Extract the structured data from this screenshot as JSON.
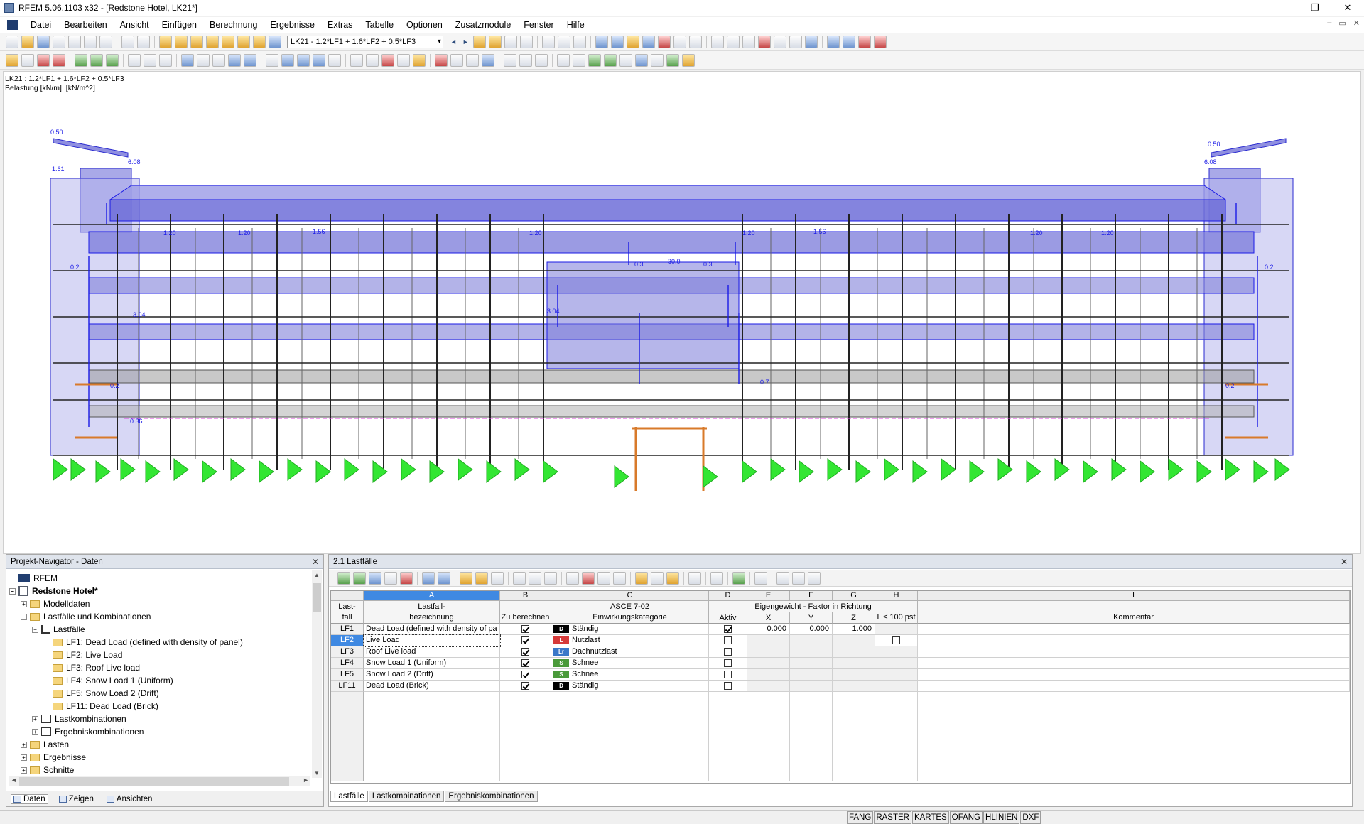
{
  "window": {
    "title": "RFEM 5.06.1103 x32 - [Redstone Hotel, LK21*]",
    "minimize": "—",
    "maximize": "❐",
    "close": "✕"
  },
  "menu": [
    "Datei",
    "Bearbeiten",
    "Ansicht",
    "Einfügen",
    "Berechnung",
    "Ergebnisse",
    "Extras",
    "Tabelle",
    "Optionen",
    "Zusatzmodule",
    "Fenster",
    "Hilfe"
  ],
  "mdi_controls": [
    "–",
    "▭",
    "✕"
  ],
  "toolbar": {
    "loadcase_combo": "LK21 - 1.2*LF1 + 1.6*LF2 + 0.5*LF3",
    "prev_arrow": "◄",
    "next_arrow": "►"
  },
  "viewport": {
    "info_line1": "LK21 : 1.2*LF1 + 1.6*LF2 + 0.5*LF3",
    "info_line2": "Belastung [kN/m], [kN/m^2]",
    "load_labels": {
      "top_left": "0.50",
      "top_right": "0.50",
      "parapet_left": "6.08",
      "parapet_right": "6.08",
      "side_left": "1.61",
      "floor_load": "1.20",
      "floor_load_b": "1.56",
      "center_span": "30.0",
      "wall_load": "3.04",
      "small_a": "0.2",
      "small_b": "0.3",
      "small_c": "0.7",
      "small_d": "0.36"
    },
    "colors": {
      "slab_fill": "#6f6fd8",
      "load_arrow": "#1a1ae6",
      "support": "#33e633",
      "steel": "#d87a2a"
    }
  },
  "navigator": {
    "title": "Projekt-Navigator - Daten",
    "close": "✕",
    "tree": [
      {
        "label": "RFEM",
        "level": 0,
        "icon": "root",
        "exp": ""
      },
      {
        "label": "Redstone Hotel*",
        "level": 0,
        "icon": "model",
        "exp": "−",
        "bold": true
      },
      {
        "label": "Modelldaten",
        "level": 1,
        "icon": "folder",
        "exp": "+"
      },
      {
        "label": "Lastfälle und Kombinationen",
        "level": 1,
        "icon": "folder",
        "exp": "−"
      },
      {
        "label": "Lastfälle",
        "level": 2,
        "icon": "lc",
        "exp": "−"
      },
      {
        "label": "LF1: Dead Load (defined with density of panel)",
        "level": 3,
        "icon": "folder",
        "exp": ""
      },
      {
        "label": "LF2: Live Load",
        "level": 3,
        "icon": "folder",
        "exp": ""
      },
      {
        "label": "LF3: Roof Live load",
        "level": 3,
        "icon": "folder",
        "exp": ""
      },
      {
        "label": "LF4: Snow Load 1 (Uniform)",
        "level": 3,
        "icon": "folder",
        "exp": ""
      },
      {
        "label": "LF5: Snow Load 2 (Drift)",
        "level": 3,
        "icon": "folder",
        "exp": ""
      },
      {
        "label": "LF11: Dead Load (Brick)",
        "level": 3,
        "icon": "folder",
        "exp": ""
      },
      {
        "label": "Lastkombinationen",
        "level": 2,
        "icon": "combo",
        "exp": "+"
      },
      {
        "label": "Ergebniskombinationen",
        "level": 2,
        "icon": "combo",
        "exp": "+"
      },
      {
        "label": "Lasten",
        "level": 1,
        "icon": "folder",
        "exp": "+"
      },
      {
        "label": "Ergebnisse",
        "level": 1,
        "icon": "folder",
        "exp": "+"
      },
      {
        "label": "Schnitte",
        "level": 1,
        "icon": "folder",
        "exp": "+"
      }
    ],
    "tabs": [
      "Daten",
      "Zeigen",
      "Ansichten"
    ]
  },
  "table": {
    "title": "2.1 Lastfälle",
    "close": "✕",
    "col_letters": [
      "A",
      "B",
      "C",
      "D",
      "E",
      "F",
      "G",
      "H",
      "I"
    ],
    "headers": {
      "lastfall": "Last-\nfall",
      "bezeichnung": "Lastfall-\nbezeichnung",
      "zu_berechnen": "Zu berechnen",
      "asce_top": "ASCE 7-02",
      "asce_bottom": "Einwirkungskategorie",
      "eigengewicht": "Eigengewicht  -  Faktor in Richtung",
      "aktiv": "Aktiv",
      "x": "X",
      "y": "Y",
      "z": "Z",
      "l100": "L ≤ 100 psf",
      "kommentar": "Kommentar"
    },
    "rows": [
      {
        "id": "LF1",
        "name": "Dead Load (defined with density of pa",
        "calc": true,
        "cat_code": "D",
        "cat_color": "#000000",
        "category": "Ständig",
        "aktiv": true,
        "x": "0.000",
        "y": "0.000",
        "z": "1.000",
        "l100": false,
        "l100_box": false
      },
      {
        "id": "LF2",
        "name": "Live Load",
        "calc": true,
        "cat_code": "L",
        "cat_color": "#d63a3a",
        "category": "Nutzlast",
        "aktiv": false,
        "x": "",
        "y": "",
        "z": "",
        "l100": false,
        "l100_box": true
      },
      {
        "id": "LF3",
        "name": "Roof Live load",
        "calc": true,
        "cat_code": "Lr",
        "cat_color": "#3a78c8",
        "category": "Dachnutzlast",
        "aktiv": false,
        "x": "",
        "y": "",
        "z": "",
        "l100": false,
        "l100_box": false
      },
      {
        "id": "LF4",
        "name": "Snow Load 1 (Uniform)",
        "calc": true,
        "cat_code": "S",
        "cat_color": "#4a9a3a",
        "category": "Schnee",
        "aktiv": false,
        "x": "",
        "y": "",
        "z": "",
        "l100": false,
        "l100_box": false
      },
      {
        "id": "LF5",
        "name": "Snow Load 2 (Drift)",
        "calc": true,
        "cat_code": "S",
        "cat_color": "#4a9a3a",
        "category": "Schnee",
        "aktiv": false,
        "x": "",
        "y": "",
        "z": "",
        "l100": false,
        "l100_box": false
      },
      {
        "id": "LF11",
        "name": "Dead Load (Brick)",
        "calc": true,
        "cat_code": "D",
        "cat_color": "#000000",
        "category": "Ständig",
        "aktiv": false,
        "x": "",
        "y": "",
        "z": "",
        "l100": false,
        "l100_box": false
      }
    ],
    "selected_row": "LF2",
    "tabs": [
      "Lastfälle",
      "Lastkombinationen",
      "Ergebniskombinationen"
    ]
  },
  "statusbar": [
    "FANG",
    "RASTER",
    "KARTES",
    "OFANG",
    "HLINIEN",
    "DXF"
  ]
}
